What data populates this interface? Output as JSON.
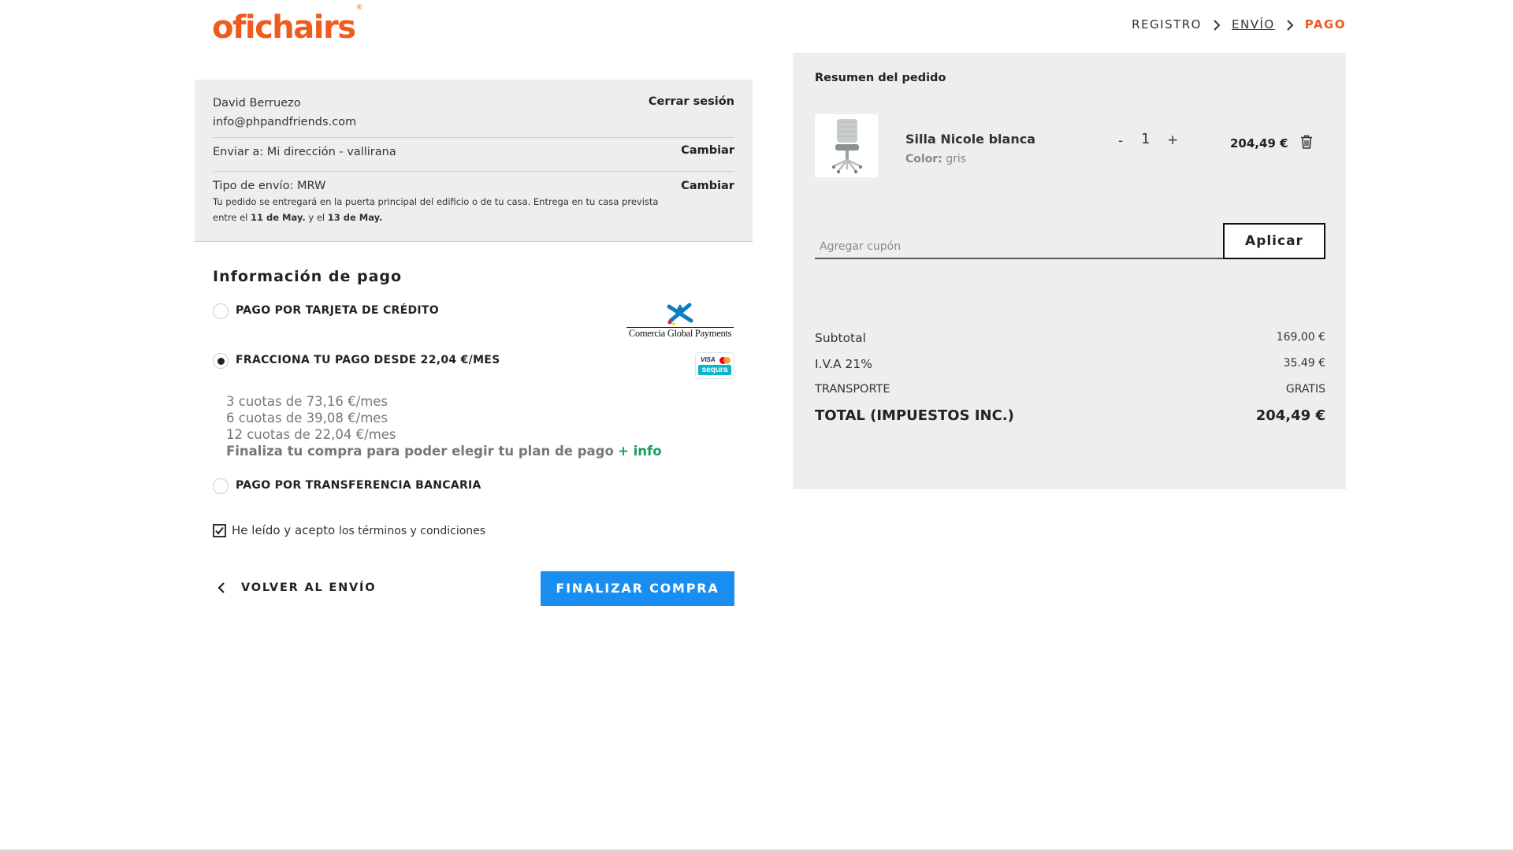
{
  "header": {
    "logo_text": "oficha",
    "logo_accent": "#ef5a1e",
    "breadcrumb": [
      {
        "label": "REGISTRO",
        "state": "done"
      },
      {
        "label": "ENVÍO",
        "state": "link"
      },
      {
        "label": "PAGO",
        "state": "current"
      }
    ]
  },
  "account": {
    "name": "David Berruezo",
    "email": "info@phpandfriends.com",
    "logout_label": "Cerrar sesión",
    "ship_to": "Enviar a: Mi dirección - vallirana",
    "ship_to_action": "Cambiar",
    "ship_type": "Tipo de envío: MRW",
    "ship_type_action": "Cambiar",
    "delivery_note_1": "Tu pedido se entregará en la puerta principal del edificio o de tu casa. Entrega en tu casa prevista",
    "delivery_note_2a": "entre el ",
    "delivery_date_1": "11 de May.",
    "delivery_note_2b": " y el ",
    "delivery_date_2": "13 de May."
  },
  "payment": {
    "title": "Información de pago",
    "options": [
      {
        "label": "PAGO POR TARJETA DE CRÉDITO",
        "selected": false,
        "logo": "Comercia Global Payments"
      },
      {
        "label": "FRACCIONA TU PAGO DESDE 22,04 €/MES",
        "selected": true,
        "logo": "sequra"
      },
      {
        "label": "PAGO POR TRANSFERENCIA BANCARIA",
        "selected": false
      }
    ],
    "cgp_logo_text": "Comercia Global Payments",
    "sequra_visa": "VISA",
    "sequra_text": "sequra",
    "plans": [
      "3 cuotas de 73,16 €/mes",
      "6 cuotas de 39,08 €/mes",
      "12 cuotas de 22,04 €/mes"
    ],
    "plans_note": "Finaliza tu compra para poder elegir tu plan de pago",
    "plans_more": "+ info",
    "terms_prefix": "He leído y acepto",
    "terms_link": "los términos y condiciones",
    "terms_checked": true,
    "back_label": "VOLVER AL ENVÍO",
    "finalize_label": "FINALIZAR COMPRA"
  },
  "summary": {
    "title": "Resumen del pedido",
    "product": {
      "name": "Silla Nicole blanca",
      "color_label": "Color:",
      "color_value": "gris",
      "qty_minus": "-",
      "qty": "1",
      "qty_plus": "+",
      "price": "204,49 €"
    },
    "coupon_placeholder": "Agregar cupón",
    "coupon_value": "",
    "coupon_button": "Aplicar",
    "subtotal_label": "Subtotal",
    "subtotal_value": "169,00 €",
    "iva_label": "I.V.A 21%",
    "iva_value": "35.49 €",
    "shipping_label": "TRANSPORTE",
    "shipping_value": "GRATIS",
    "total_label": "TOTAL (IMPUESTOS INC.)",
    "total_value": "204,49 €"
  },
  "colors": {
    "primary_button": "#1a8ef0",
    "panel_bg": "#eeeeee",
    "info_link": "#1a9e5c"
  }
}
